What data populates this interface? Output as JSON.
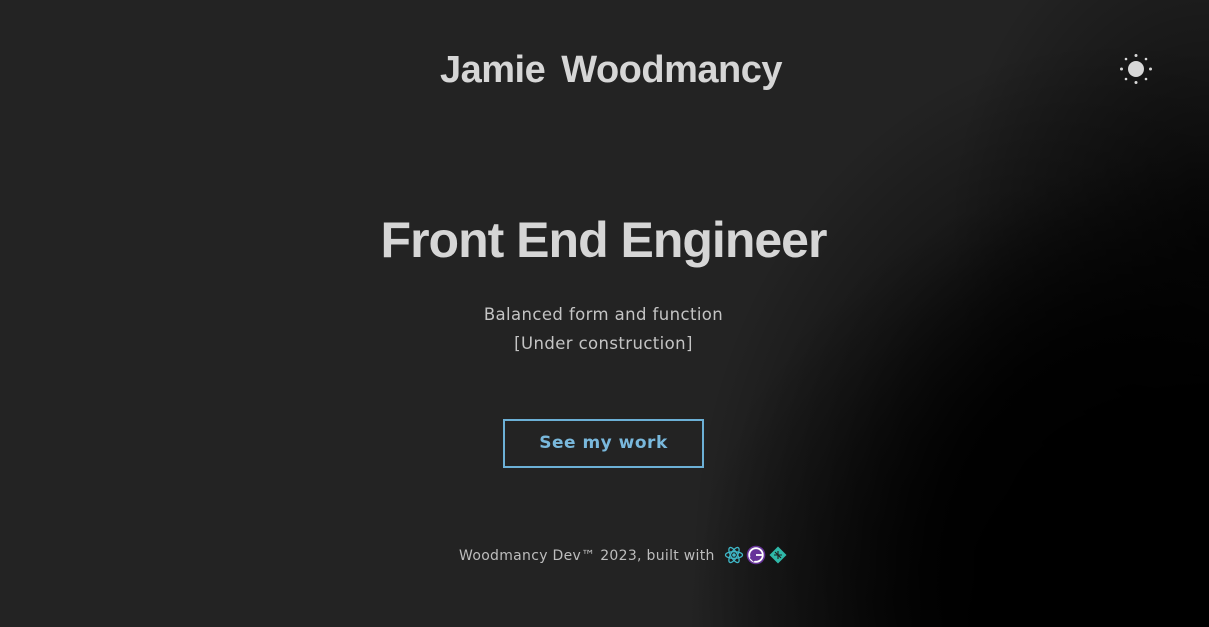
{
  "header": {
    "site_title": "Jamie Woodmancy",
    "theme_toggle_icon": "sun-icon"
  },
  "hero": {
    "title": "Front End Engineer",
    "tagline_line1": "Balanced form and function",
    "tagline_line2": "[Under construction]",
    "cta_label": "See my work"
  },
  "footer": {
    "text": "Woodmancy Dev™ 2023, built with",
    "tech_icons": [
      "react-icon",
      "gatsby-icon",
      "netlify-icon"
    ]
  },
  "colors": {
    "background": "#232323",
    "text": "#d6d6d6",
    "accent": "#6cb0d6",
    "react": "#3fb8c8",
    "gatsby": "#663399",
    "netlify": "#2fb8a8"
  }
}
